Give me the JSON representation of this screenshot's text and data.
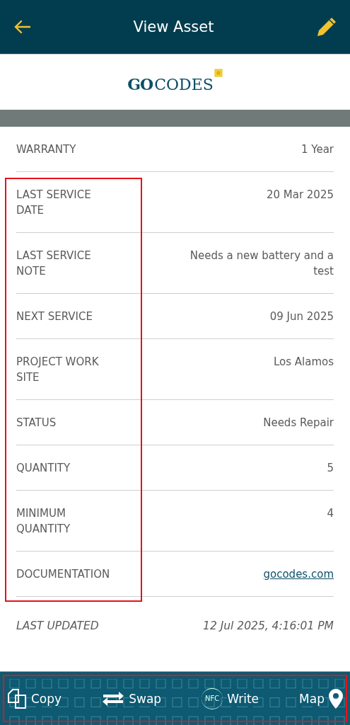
{
  "header": {
    "title": "View Asset"
  },
  "logo": {
    "strong": "GO",
    "rest": "CODES"
  },
  "fields": [
    {
      "label": "WARRANTY",
      "value": "1 Year",
      "kind": "text",
      "highlighted": false
    },
    {
      "label": "LAST SERVICE DATE",
      "value": "20 Mar 2025",
      "kind": "text",
      "highlighted": true
    },
    {
      "label": "LAST SERVICE NOTE",
      "value": "Needs a new battery and a test",
      "kind": "text",
      "highlighted": true
    },
    {
      "label": "NEXT SERVICE",
      "value": "09 Jun 2025",
      "kind": "text",
      "highlighted": true
    },
    {
      "label": "PROJECT WORK SITE",
      "value": "Los Alamos",
      "kind": "text",
      "highlighted": true
    },
    {
      "label": "STATUS",
      "value": "Needs Repair",
      "kind": "text",
      "highlighted": true
    },
    {
      "label": "QUANTITY",
      "value": "5",
      "kind": "text",
      "highlighted": true
    },
    {
      "label": "MINIMUM QUANTITY",
      "value": "4",
      "kind": "text",
      "highlighted": true
    },
    {
      "label": "DOCUMENTATION",
      "value": "gocodes.com",
      "kind": "link",
      "highlighted": true
    }
  ],
  "last_updated": {
    "label": "LAST UPDATED",
    "value": "12 Jul 2025, 4:16:01 PM"
  },
  "toolbar": {
    "highlighted": true,
    "actions": [
      {
        "kind": "copy",
        "label": "Copy"
      },
      {
        "kind": "swap",
        "label": "Swap"
      },
      {
        "kind": "nfc",
        "label": "Write",
        "badge": "NFC"
      },
      {
        "kind": "map",
        "label": "Map"
      }
    ]
  }
}
